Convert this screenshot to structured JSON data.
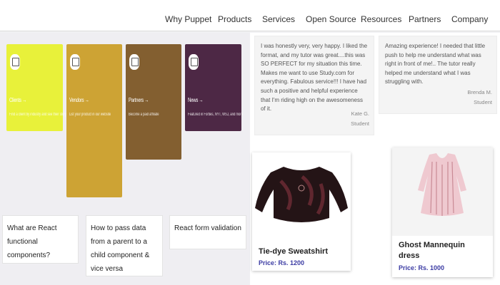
{
  "nav": {
    "items": [
      "Why Puppet",
      "Products",
      "Services",
      "Open Source",
      "Resources",
      "Partners",
      "Company"
    ]
  },
  "tiles": [
    {
      "title": "Clients →",
      "desc": "Find a client by industry and see their story",
      "color": "#e8f13a"
    },
    {
      "title": "Vendors →",
      "desc": "List your product in our website",
      "color": "#cda334"
    },
    {
      "title": "Partners →",
      "desc": "Become a paid affiliate",
      "color": "#835f30"
    },
    {
      "title": "News →",
      "desc": "Featured in Forbes, NYT, WSJ, and more",
      "color": "#4d2845"
    }
  ],
  "questions": [
    "What are React functional components?",
    "How to pass data from a parent to a child component & vice versa",
    "React form validation"
  ],
  "testimonials": [
    {
      "text": "I was honestly very, very happy. I liked the format, and my tutor was great....this was SO PERFECT for my situation this time. Makes me want to use Study.com for everything. Fabulous service!!! I have had such a positive and helpful experience that I'm riding high on the awesomeness of it.",
      "name": "Kate G.",
      "role": "Student"
    },
    {
      "text": "Amazing experience! I needed that little push to help me understand what was right in front of me!.. The tutor really helped me understand what I was struggling with.",
      "name": "Brenda M.",
      "role": "Student"
    }
  ],
  "products": [
    {
      "name": "Tie-dye Sweatshirt",
      "price": "Price: Rs. 1200"
    },
    {
      "name": "Ghost Mannequin dress",
      "price": "Price: Rs. 1000"
    }
  ]
}
